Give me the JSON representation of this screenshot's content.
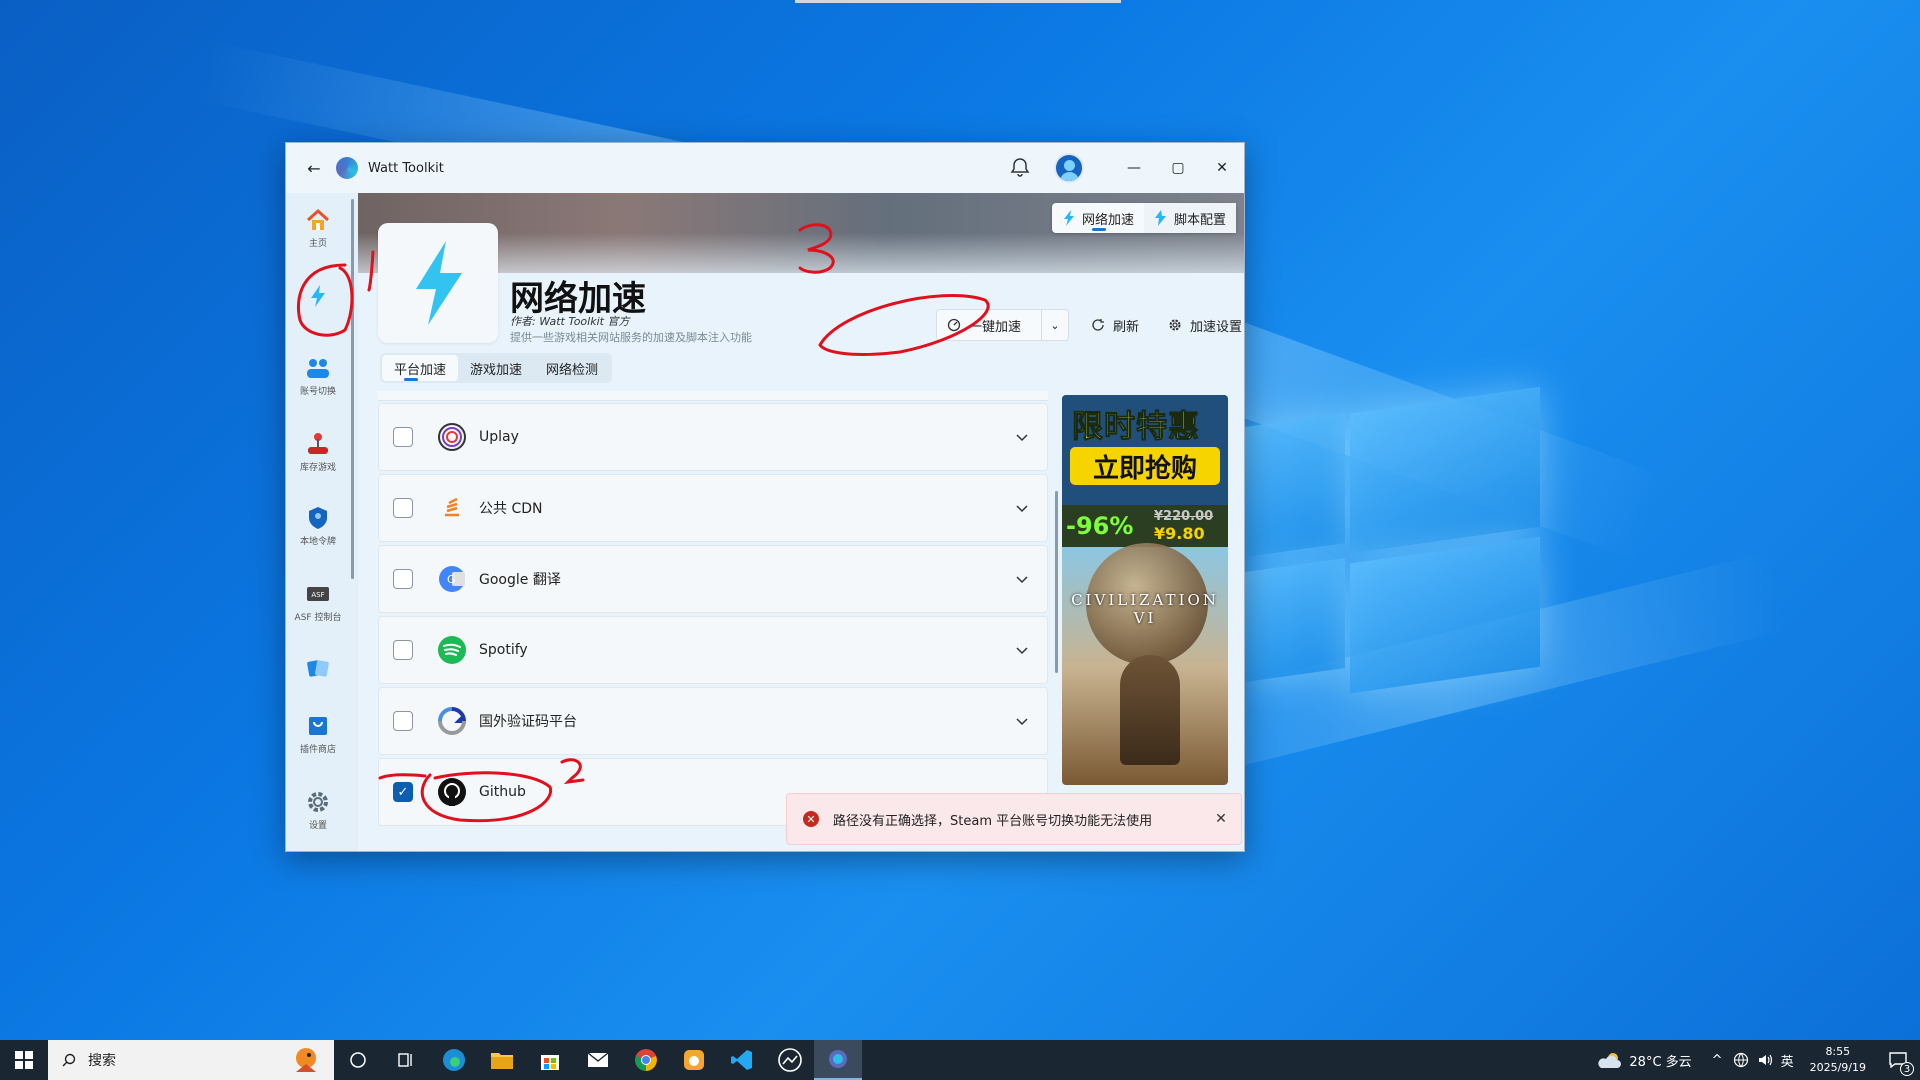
{
  "window": {
    "title": "Watt Toolkit"
  },
  "sidebar": {
    "items": [
      {
        "label": "主页",
        "icon": "home-icon"
      },
      {
        "label": "",
        "icon": "lightning-icon"
      },
      {
        "label": "账号切换",
        "icon": "users-icon"
      },
      {
        "label": "库存游戏",
        "icon": "joystick-icon"
      },
      {
        "label": "本地令牌",
        "icon": "shield-icon"
      },
      {
        "label": "ASF 控制台",
        "icon": "asf-icon"
      },
      {
        "label": "",
        "icon": "cards-icon"
      },
      {
        "label": "插件商店",
        "icon": "store-icon"
      },
      {
        "label": "设置",
        "icon": "gear-icon"
      }
    ]
  },
  "header": {
    "segments": [
      "网络加速",
      "脚本配置"
    ],
    "title": "网络加速",
    "author": "作者:  Watt Toolkit 官方",
    "description": "提供一些游戏相关网站服务的加速及脚本注入功能",
    "one_click": "一键加速",
    "refresh": "刷新",
    "settings": "加速设置",
    "more": "···"
  },
  "tabs": [
    "平台加速",
    "游戏加速",
    "网络检测"
  ],
  "services": [
    {
      "name": "Uplay",
      "checked": false,
      "icon": "uplay-icon"
    },
    {
      "name": "公共 CDN",
      "checked": false,
      "icon": "cdn-icon"
    },
    {
      "name": "Google 翻译",
      "checked": false,
      "icon": "google-translate-icon"
    },
    {
      "name": "Spotify",
      "checked": false,
      "icon": "spotify-icon"
    },
    {
      "name": "国外验证码平台",
      "checked": false,
      "icon": "recaptcha-icon"
    },
    {
      "name": "Github",
      "checked": true,
      "icon": "github-icon"
    }
  ],
  "ad": {
    "line1": "限时特惠",
    "line2": "立即抢购",
    "discount": "-96%",
    "old_price": "¥220.00",
    "new_price": "¥9.80",
    "game": "CIVILIZATION VI"
  },
  "toast": {
    "message": "路径没有正确选择，Steam 平台账号切换功能无法使用"
  },
  "taskbar": {
    "search": "搜索",
    "weather": "28°C 多云",
    "ime": "英",
    "time": "8:55",
    "date": "2025/9/19",
    "notifications": "3"
  },
  "annotations": [
    "1",
    "2",
    "3"
  ],
  "colors": {
    "accent": "#1677d2",
    "annotation": "#e0101c",
    "error": "#c42b1c"
  }
}
